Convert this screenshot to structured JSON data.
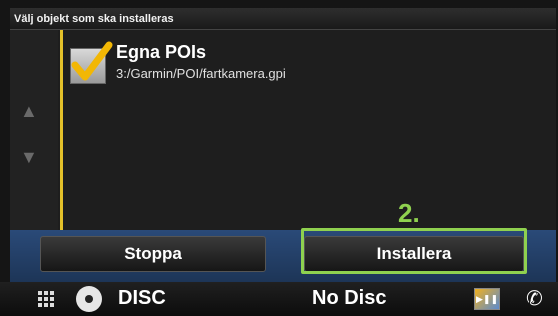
{
  "header": {
    "title": "Välj objekt som ska installeras"
  },
  "list": {
    "items": [
      {
        "checked": true,
        "title": "Egna POIs",
        "path": "3:/Garmin/POI/fartkamera.gpi"
      }
    ],
    "scroll_up_icon": "arrow-up-icon",
    "scroll_down_icon": "arrow-down-icon"
  },
  "annotation": {
    "label": "2.",
    "color": "#8fd14f"
  },
  "buttons": {
    "stop_label": "Stoppa",
    "install_label": "Installera"
  },
  "status_bar": {
    "source": "DISC",
    "disc_status": "No Disc",
    "icons": [
      "grid-menu-icon",
      "disc-icon",
      "media-icon",
      "phone-icon"
    ]
  },
  "colors": {
    "accent_highlight": "#8fd14f",
    "rail": "#e4c12a",
    "button_bar": "#2a4a78"
  }
}
